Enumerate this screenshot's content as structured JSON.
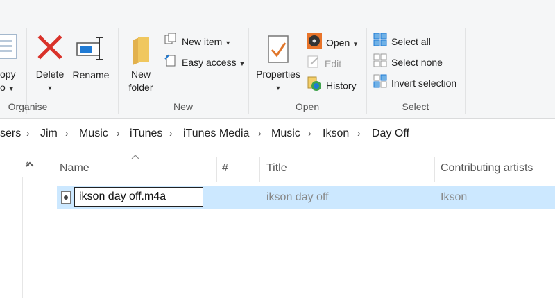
{
  "ribbon": {
    "clipboard": {
      "copy_partial": "opy",
      "paste_partial": "o",
      "label": ""
    },
    "organise": {
      "label": "Organise",
      "delete_label": "Delete",
      "rename_label": "Rename"
    },
    "new": {
      "label": "New",
      "new_folder_label_1": "New",
      "new_folder_label_2": "folder",
      "new_item_label": "New item",
      "easy_access_label": "Easy access"
    },
    "open": {
      "label": "Open",
      "properties_label": "Properties",
      "open_label": "Open",
      "edit_label": "Edit",
      "history_label": "History"
    },
    "select": {
      "label": "Select",
      "select_all_label": "Select all",
      "select_none_label": "Select none",
      "invert_selection_label": "Invert selection"
    }
  },
  "breadcrumb": [
    "sers",
    "Jim",
    "Music",
    "iTunes",
    "iTunes Media",
    "Music",
    "Ikson",
    "Day Off"
  ],
  "columns": {
    "name": "Name",
    "number": "#",
    "title": "Title",
    "contributing_artists": "Contributing artists"
  },
  "rows": [
    {
      "name": "ikson day off.m4a",
      "title": "ikson day off",
      "artist": "Ikson"
    }
  ],
  "icons": {
    "delete": "red-x-icon",
    "rename": "rename-icon",
    "new_folder": "folder-icon",
    "properties": "properties-checklist-icon",
    "open": "media-disc-icon",
    "edit": "edit-icon",
    "history": "history-icon",
    "select_all": "select-all-icon",
    "select_none": "select-none-icon",
    "invert": "invert-selection-icon"
  },
  "colors": {
    "selection": "#cce8ff",
    "delete_red": "#d9322a",
    "folder_yellow": "#f0c75e",
    "accent_blue": "#1f7ad4"
  }
}
